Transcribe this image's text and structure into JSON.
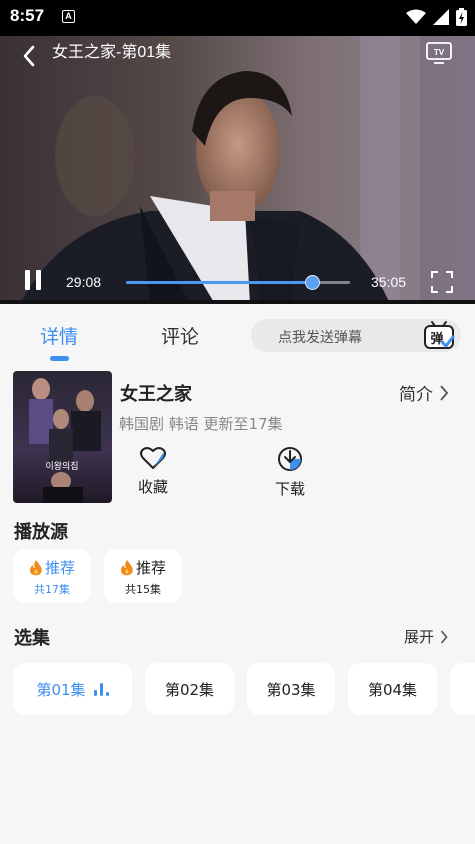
{
  "status_bar": {
    "time": "8:57",
    "notification_icon": "A"
  },
  "player": {
    "title": "女王之家-第01集",
    "current_time": "29:08",
    "total_time": "35:05",
    "progress": 0.83
  },
  "tabs": {
    "detail": "详情",
    "comment": "评论"
  },
  "danmu": {
    "placeholder": "点我发送弹幕",
    "icon_text": "弹"
  },
  "show": {
    "title": "女王之家",
    "intro": "简介",
    "meta": "韩国剧 韩语 更新至17集",
    "poster_text": "이왕의집",
    "favorite": "收藏",
    "download": "下载"
  },
  "sources": {
    "heading": "播放源",
    "items": [
      {
        "name": "推荐",
        "count": "共17集"
      },
      {
        "name": "推荐",
        "count": "共15集"
      }
    ]
  },
  "episodes": {
    "heading": "选集",
    "expand": "展开",
    "items": [
      "第01集",
      "第02集",
      "第03集",
      "第04集"
    ]
  },
  "colors": {
    "accent": "#3d8ff0",
    "background": "#f6f6f6"
  }
}
